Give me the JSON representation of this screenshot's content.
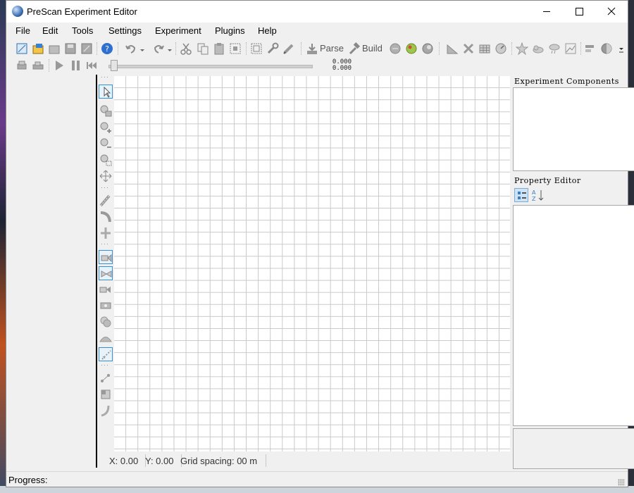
{
  "window": {
    "title": "PreScan Experiment Editor"
  },
  "menu": [
    "File",
    "Edit",
    "Tools",
    "Settings",
    "Experiment",
    "Plugins",
    "Help"
  ],
  "toolbar": {
    "parse_label": "Parse",
    "build_label": "Build"
  },
  "timeline": {
    "time_top": "0.000",
    "time_bottom": "0.000"
  },
  "panels": {
    "components_title": "Experiment Components",
    "property_title": "Property Editor"
  },
  "status": {
    "x": "X: 0.00",
    "y": "Y: 0.00",
    "grid": "Grid spacing: 00 m"
  },
  "progress": {
    "label": "Progress:"
  },
  "icons": {
    "window_controls": [
      "minimize-icon",
      "maximize-icon",
      "close-icon"
    ]
  }
}
